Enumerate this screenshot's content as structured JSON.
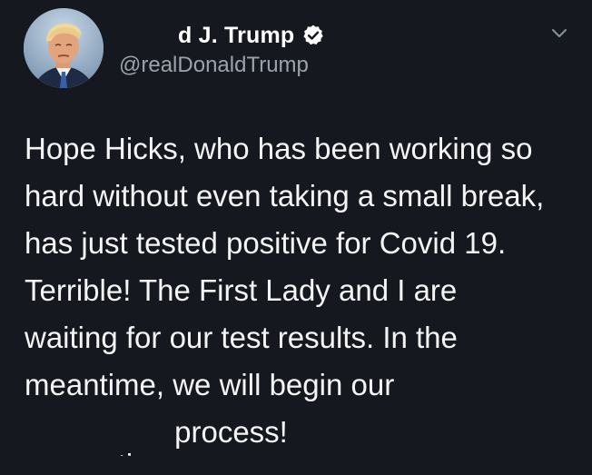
{
  "author": {
    "display_name": "d J. Trump",
    "handle": "@realDonaldTrump",
    "verified": true,
    "verified_icon": "verified-badge-icon",
    "avatar_icon": "profile-avatar"
  },
  "menu": {
    "icon": "chevron-down-icon"
  },
  "tweet": {
    "lines": [
      "Hope Hicks, who has been working so",
      "hard without even taking a small break,",
      "has just tested positive for Covid 19.",
      "Terrible! The First Lady and I are",
      "waiting for our test results. In the",
      "meantime, we will begin our"
    ],
    "last_line_clipped": "quarantine",
    "last_line_rest": " process!"
  },
  "colors": {
    "background": "#15181f",
    "text": "#f4f4f4",
    "handle": "#9aa3ab",
    "verified_badge": "#ffffff"
  }
}
